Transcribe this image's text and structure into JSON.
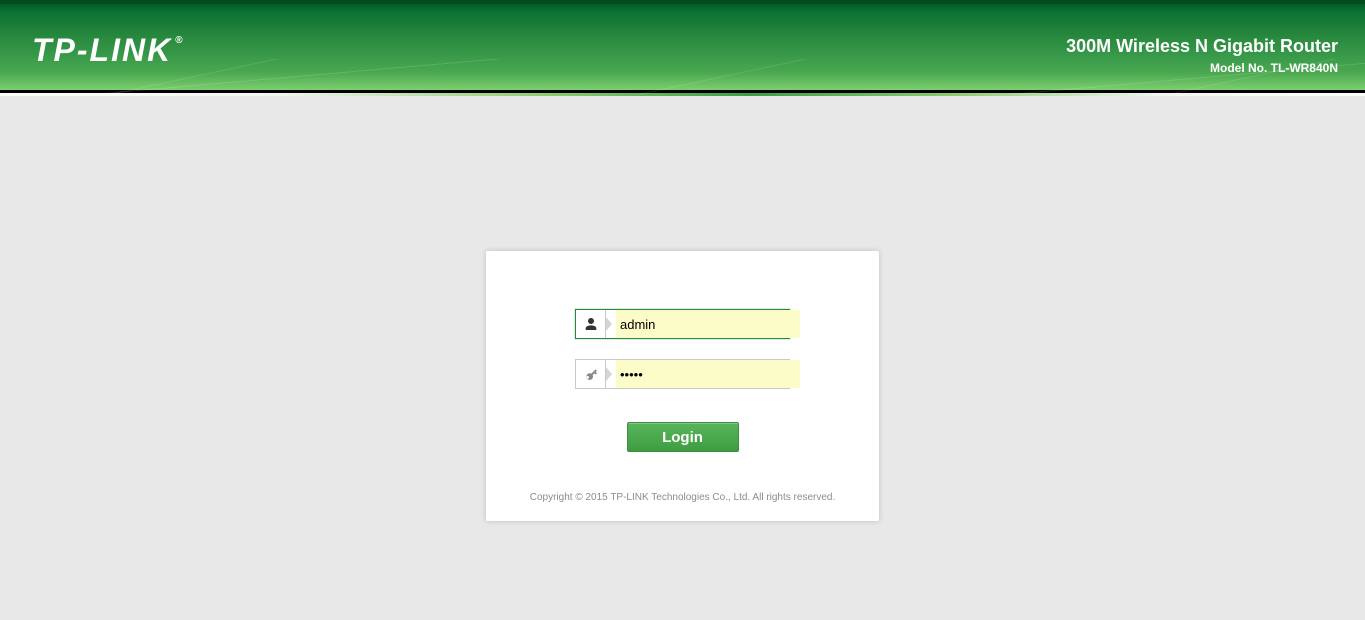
{
  "header": {
    "brand_name": "TP-LINK",
    "reg_mark": "®",
    "product_name": "300M Wireless N Gigabit Router",
    "model_no": "Model No. TL-WR840N"
  },
  "login": {
    "username_value": "admin",
    "password_value": "•••••",
    "login_button_label": "Login"
  },
  "footer": {
    "copyright": "Copyright © 2015 TP-LINK Technologies Co., Ltd. All rights reserved."
  }
}
